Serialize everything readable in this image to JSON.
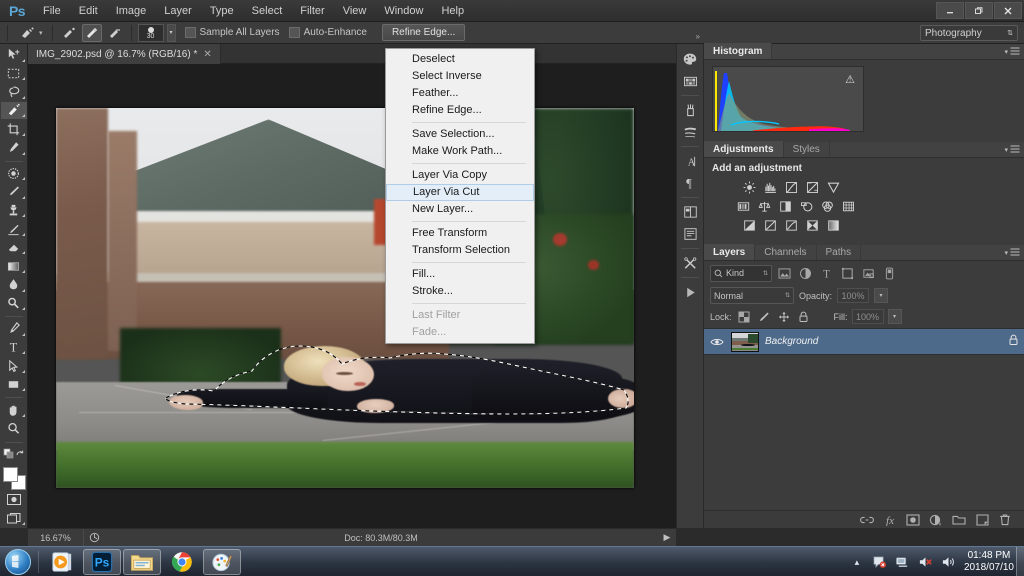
{
  "app": {
    "name": "Ps",
    "logo_color": "#5aa7d6",
    "accent_color": "#4d6a8a"
  },
  "titlebar": {
    "menus": [
      "File",
      "Edit",
      "Image",
      "Layer",
      "Type",
      "Select",
      "Filter",
      "View",
      "Window",
      "Help"
    ],
    "window_controls": [
      {
        "name": "minimize",
        "glyph": "─"
      },
      {
        "name": "restore",
        "glyph": "❐"
      },
      {
        "name": "close",
        "glyph": "✕"
      }
    ]
  },
  "options_bar": {
    "tool_icon": "quick-selection-tool",
    "mode_buttons": [
      "new-selection",
      "add-to-selection",
      "subtract-from-selection"
    ],
    "active_mode_index": 1,
    "brush_size": "30",
    "sample_all_layers_label": "Sample All Layers",
    "sample_all_layers_checked": false,
    "auto_enhance_label": "Auto-Enhance",
    "auto_enhance_checked": false,
    "refine_edge_label": "Refine Edge...",
    "workspace": "Photography"
  },
  "document": {
    "tab_title": "IMG_2902.psd @ 16.7% (RGB/16) *",
    "close_glyph": "✕"
  },
  "toolbar": {
    "tools": [
      {
        "name": "move-tool",
        "active": false
      },
      {
        "name": "rectangular-marquee-tool",
        "active": false
      },
      {
        "name": "lasso-tool",
        "active": false
      },
      {
        "name": "quick-selection-tool",
        "active": true
      },
      {
        "name": "crop-tool",
        "active": false
      },
      {
        "name": "eyedropper-tool",
        "active": false
      },
      {
        "name": "spot-healing-brush-tool",
        "active": false
      },
      {
        "name": "brush-tool",
        "active": false
      },
      {
        "name": "clone-stamp-tool",
        "active": false
      },
      {
        "name": "history-brush-tool",
        "active": false
      },
      {
        "name": "eraser-tool",
        "active": false
      },
      {
        "name": "gradient-tool",
        "active": false
      },
      {
        "name": "blur-tool",
        "active": false
      },
      {
        "name": "dodge-tool",
        "active": false
      },
      {
        "name": "pen-tool",
        "active": false
      },
      {
        "name": "horizontal-type-tool",
        "active": false
      },
      {
        "name": "path-selection-tool",
        "active": false
      },
      {
        "name": "rectangle-tool",
        "active": false
      },
      {
        "name": "hand-tool",
        "active": false
      },
      {
        "name": "zoom-tool",
        "active": false
      }
    ],
    "foreground_color": "#ffffff",
    "background_color": "#ffffff"
  },
  "context_menu": {
    "items": [
      {
        "label": "Deselect",
        "selected": false,
        "disabled": false,
        "separator_after": false
      },
      {
        "label": "Select Inverse",
        "selected": false,
        "disabled": false,
        "separator_after": false
      },
      {
        "label": "Feather...",
        "selected": false,
        "disabled": false,
        "separator_after": false
      },
      {
        "label": "Refine Edge...",
        "selected": false,
        "disabled": false,
        "separator_after": true
      },
      {
        "label": "Save Selection...",
        "selected": false,
        "disabled": false,
        "separator_after": false
      },
      {
        "label": "Make Work Path...",
        "selected": false,
        "disabled": false,
        "separator_after": true
      },
      {
        "label": "Layer Via Copy",
        "selected": false,
        "disabled": false,
        "separator_after": false
      },
      {
        "label": "Layer Via Cut",
        "selected": true,
        "disabled": false,
        "separator_after": false
      },
      {
        "label": "New Layer...",
        "selected": false,
        "disabled": false,
        "separator_after": true
      },
      {
        "label": "Free Transform",
        "selected": false,
        "disabled": false,
        "separator_after": false
      },
      {
        "label": "Transform Selection",
        "selected": false,
        "disabled": false,
        "separator_after": true
      },
      {
        "label": "Fill...",
        "selected": false,
        "disabled": false,
        "separator_after": false
      },
      {
        "label": "Stroke...",
        "selected": false,
        "disabled": false,
        "separator_after": true
      },
      {
        "label": "Last Filter",
        "selected": false,
        "disabled": true,
        "separator_after": false
      },
      {
        "label": "Fade...",
        "selected": false,
        "disabled": true,
        "separator_after": false
      }
    ]
  },
  "status_bar": {
    "zoom": "16.67%",
    "doc_label": "Doc: 80.3M/80.3M",
    "arrow_glyph": "▶"
  },
  "dock_rail": {
    "buttons": [
      "color-panel-icon",
      "swatches-panel-icon",
      "brush-panel-icon",
      "brush-presets-panel-icon",
      "character-panel-icon",
      "paragraph-panel-icon",
      "layer-comps-panel-icon",
      "notes-panel-icon",
      "tool-presets-panel-icon",
      "actions-panel-icon"
    ],
    "expand_glyph": "»"
  },
  "histogram_panel": {
    "tab": "Histogram",
    "warning_glyph": "⚠",
    "menu_glyph": "▾"
  },
  "adjustments_panel": {
    "tabs": [
      {
        "label": "Adjustments",
        "active": true
      },
      {
        "label": "Styles",
        "active": false
      }
    ],
    "title": "Add an adjustment",
    "row1": [
      "brightness-contrast-icon",
      "levels-icon",
      "curves-icon",
      "exposure-icon",
      "vibrance-icon"
    ],
    "row2": [
      "hue-saturation-icon",
      "color-balance-icon",
      "black-white-icon",
      "photo-filter-icon",
      "channel-mixer-icon",
      "color-lookup-icon"
    ],
    "row3": [
      "invert-icon",
      "posterize-icon",
      "threshold-icon",
      "selective-color-icon",
      "gradient-map-icon"
    ]
  },
  "layers_panel": {
    "tabs": [
      {
        "label": "Layers",
        "active": true
      },
      {
        "label": "Channels",
        "active": false
      },
      {
        "label": "Paths",
        "active": false
      }
    ],
    "filter_kind": "Kind",
    "filter_icons": [
      "filter-pixel-icon",
      "filter-adjustment-icon",
      "filter-type-icon",
      "filter-shape-icon",
      "filter-smart-object-icon"
    ],
    "filter_toggle": "filter-enable-toggle",
    "blend_mode": "Normal",
    "opacity_label": "Opacity:",
    "opacity_value": "100%",
    "lock_label": "Lock:",
    "lock_icons": [
      "lock-transparency-icon",
      "lock-image-icon",
      "lock-position-icon",
      "lock-all-icon"
    ],
    "fill_label": "Fill:",
    "fill_value": "100%",
    "layers": [
      {
        "name": "Background",
        "visible": true,
        "locked": true,
        "selected": true
      }
    ],
    "footer_icons": [
      "link-layers-icon",
      "layer-style-icon",
      "layer-mask-icon",
      "new-fill-adjustment-icon",
      "new-group-icon",
      "new-layer-icon",
      "delete-layer-icon"
    ]
  },
  "taskbar": {
    "start_label": "start-orb",
    "items": [
      {
        "name": "windows-media-player",
        "running": false
      },
      {
        "name": "photoshop",
        "running": true
      },
      {
        "name": "windows-explorer",
        "running": true
      },
      {
        "name": "google-chrome",
        "running": false
      },
      {
        "name": "paint",
        "running": true
      }
    ],
    "tray_icons": [
      "tray-expand-icon",
      "action-center-icon",
      "network-icon",
      "volume-muted-icon",
      "speaker-icon"
    ],
    "tray_expand_glyph": "▴",
    "time": "01:48 PM",
    "date": "2018/07/10"
  }
}
